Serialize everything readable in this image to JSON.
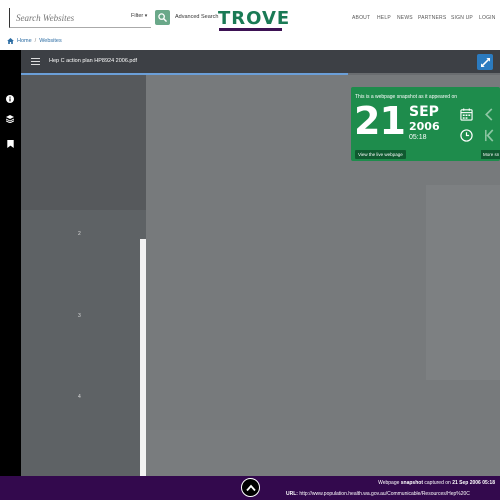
{
  "header": {
    "search_placeholder": "Search Websites",
    "filter_label": "Filter",
    "advanced_search_label": "Advanced Search",
    "logo_text": "TROVE",
    "nav": [
      "ABOUT",
      "HELP",
      "NEWS",
      "PARTNERS",
      "SIGN UP",
      "LOGIN"
    ]
  },
  "breadcrumb": [
    "Home",
    "Websites"
  ],
  "viewer": {
    "document_title": "Hep C action plan HP8924 2006.pdf",
    "thumbnail_pages": [
      "2",
      "3",
      "4"
    ]
  },
  "snapshot": {
    "heading": "This is a webpage snapshot as it appeared on",
    "day": "21",
    "month": "SEP",
    "year": "2006",
    "time": "05:18",
    "live_button": "View the live webpage",
    "more_button": "More sn"
  },
  "footer": {
    "line1_prefix": "Webpage ",
    "line1_bold1": "snapshot",
    "line1_mid": " captured on ",
    "line1_bold2": "21 Sep 2006 05:18",
    "url_label": "URL:",
    "url_value": "http://www.population.health.wa.gov.au/Communicable/Resources/Hep%20C"
  },
  "colors": {
    "brand_green": "#1a7a55",
    "brand_purple": "#33094d",
    "snapshot_green": "#1e8c4c",
    "link_blue": "#2b6ca3"
  },
  "icons": {
    "search": "search-icon",
    "filter_caret": "caret-down-icon",
    "home": "home-icon",
    "info": "info-icon",
    "layers": "layers-icon",
    "bookmark": "bookmark-icon",
    "menu": "hamburger-menu-icon",
    "expand": "expand-icon",
    "calendar": "calendar-icon",
    "clock": "clock-icon",
    "prev": "chevron-left-icon",
    "first": "first-page-icon",
    "scroll_top": "chevron-up-icon"
  }
}
